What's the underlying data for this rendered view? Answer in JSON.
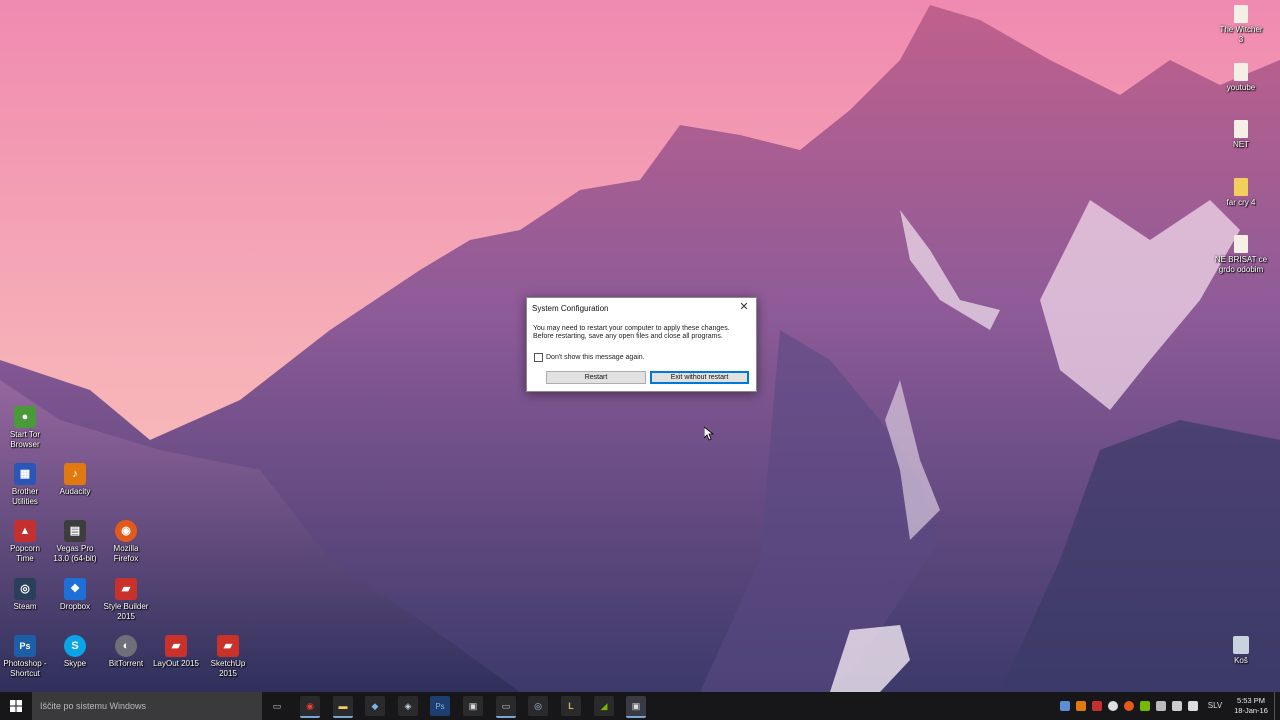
{
  "desktop": {
    "icons_left": [
      {
        "label1": "Start Tor",
        "label2": "Browser",
        "icon": "tor-icon",
        "color": "#4a9a3a",
        "glyph": "●"
      },
      {
        "label1": "Brother",
        "label2": "Utilities",
        "icon": "brother-utilities-icon",
        "color": "#2b56b8",
        "glyph": "▦"
      },
      {
        "label1": "Audacity",
        "label2": "",
        "icon": "audacity-icon",
        "color": "#e07a10",
        "glyph": "♪"
      },
      {
        "label1": "Popcorn",
        "label2": "Time",
        "icon": "popcorn-time-icon",
        "color": "#c43030",
        "glyph": "▲"
      },
      {
        "label1": "Vegas Pro",
        "label2": "13.0 (64-bit)",
        "icon": "vegas-pro-icon",
        "color": "#3d3d3d",
        "glyph": "▤"
      },
      {
        "label1": "Mozilla",
        "label2": "Firefox",
        "icon": "firefox-icon",
        "color": "#e35a1b",
        "glyph": "◉"
      },
      {
        "label1": "Steam",
        "label2": "",
        "icon": "steam-icon",
        "color": "#2a3f5a",
        "glyph": "◎"
      },
      {
        "label1": "Dropbox",
        "label2": "",
        "icon": "dropbox-icon",
        "color": "#1f6fd8",
        "glyph": "❖"
      },
      {
        "label1": "Style Builder",
        "label2": "2015",
        "icon": "style-builder-icon",
        "color": "#c8322b",
        "glyph": "▰"
      },
      {
        "label1": "Photoshop -",
        "label2": "Shortcut",
        "icon": "photoshop-icon",
        "color": "#1d5ea8",
        "glyph": "Ps"
      },
      {
        "label1": "Skype",
        "label2": "",
        "icon": "skype-icon",
        "color": "#0aa5e8",
        "glyph": "S"
      },
      {
        "label1": "BitTorrent",
        "label2": "",
        "icon": "bittorrent-icon",
        "color": "#6f6f7a",
        "glyph": "◐"
      },
      {
        "label1": "LayOut 2015",
        "label2": "",
        "icon": "layout-icon",
        "color": "#c8322b",
        "glyph": "▰"
      },
      {
        "label1": "SketchUp",
        "label2": "2015",
        "icon": "sketchup-icon",
        "color": "#c8322b",
        "glyph": "▰"
      }
    ],
    "icons_right": [
      {
        "label1": "The Witcher",
        "label2": "3",
        "icon": "file-icon"
      },
      {
        "label1": "youtube",
        "label2": "",
        "icon": "file-icon"
      },
      {
        "label1": "NET",
        "label2": "",
        "icon": "file-icon"
      },
      {
        "label1": "far cry 4",
        "label2": "",
        "icon": "folder-icon"
      },
      {
        "label1": "NE BRISAT ce",
        "label2": "grdo odobim",
        "icon": "file-icon"
      },
      {
        "label1": "Koš",
        "label2": "",
        "icon": "recycle-bin-icon"
      }
    ]
  },
  "dialog": {
    "title": "System Configuration",
    "message_line1": "You may need to restart your computer to apply these changes.",
    "message_line2": "Before restarting, save any open files and close all programs.",
    "checkbox_label": "Don't show this message again.",
    "restart_label": "Restart",
    "exit_label": "Exit without restart",
    "close_glyph": "✕"
  },
  "taskbar": {
    "search_placeholder": "Iščite po sistemu Windows",
    "apps": [
      {
        "name": "task-view-icon",
        "color": "#17171a",
        "glyph": "▭"
      },
      {
        "name": "chrome-icon",
        "color": "#2a2a2d",
        "glyph": "◉"
      },
      {
        "name": "file-explorer-icon",
        "color": "#2a2a2d",
        "glyph": "▬"
      },
      {
        "name": "app-icon",
        "color": "#2a2a2d",
        "glyph": "◆"
      },
      {
        "name": "app-icon-2",
        "color": "#2a2a2d",
        "glyph": "◈"
      },
      {
        "name": "photoshop-icon",
        "color": "#1d3e6e",
        "glyph": "Ps"
      },
      {
        "name": "media-icon",
        "color": "#2a2a2d",
        "glyph": "▣"
      },
      {
        "name": "terminal-icon",
        "color": "#2a2a2d",
        "glyph": "▭"
      },
      {
        "name": "steam-icon",
        "color": "#2a2a2d",
        "glyph": "◎"
      },
      {
        "name": "league-icon",
        "color": "#2a2a2d",
        "glyph": "L"
      },
      {
        "name": "nvidia-icon",
        "color": "#2a2a2d",
        "glyph": "◢"
      },
      {
        "name": "system-config-icon",
        "color": "#3a3a44",
        "glyph": "▣"
      }
    ],
    "language": "SLV",
    "time": "5:53 PM",
    "date": "18-Jan-16"
  }
}
